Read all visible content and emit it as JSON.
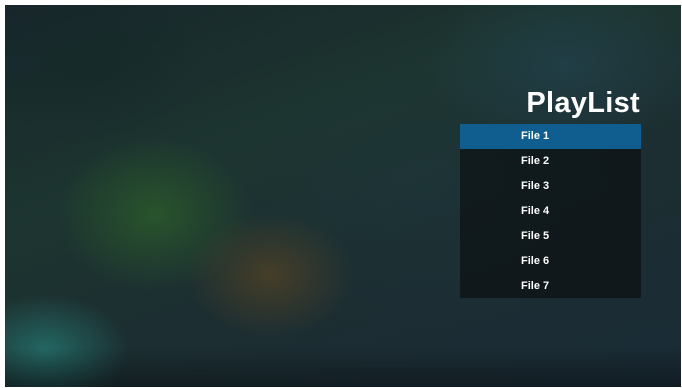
{
  "header": {
    "title": "PlayList"
  },
  "playlist": {
    "selected_index": 0,
    "items": [
      {
        "label": "File 1"
      },
      {
        "label": "File 2"
      },
      {
        "label": "File 3"
      },
      {
        "label": "File 4"
      },
      {
        "label": "File 5"
      },
      {
        "label": "File 6"
      },
      {
        "label": "File 7"
      }
    ]
  },
  "colors": {
    "selected_highlight": "#0f5e8f",
    "panel_background": "#0c1014",
    "text": "#ffffff"
  }
}
